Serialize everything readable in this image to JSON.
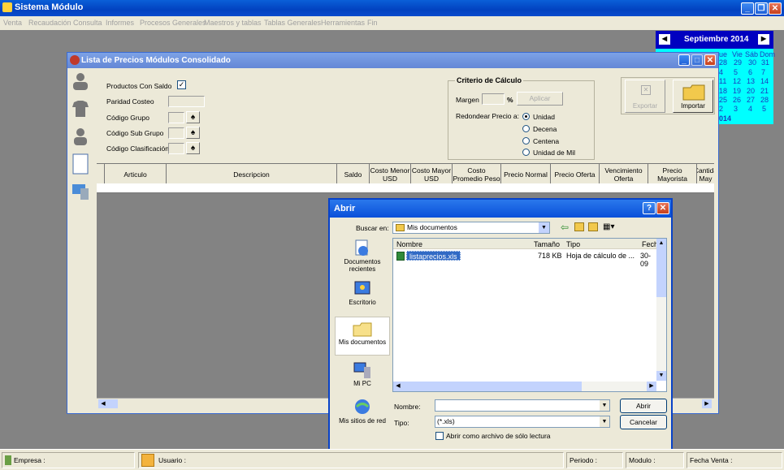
{
  "app": {
    "title": "Sistema Módulo"
  },
  "menu": [
    "Venta",
    "Recaudación",
    "Consulta",
    "Informes",
    "Procesos Generales",
    "Maestros y tablas",
    "Tablas Generales",
    "Herramientas",
    "Fin"
  ],
  "calendar": {
    "month_label": "Septiembre 2014",
    "day_headers": [
      "ue",
      "Vie",
      "Sáb",
      "Dom"
    ],
    "rows": [
      [
        "28",
        "29",
        "30",
        "31"
      ],
      [
        "4",
        "5",
        "6",
        "7"
      ],
      [
        "11",
        "12",
        "13",
        "14"
      ],
      [
        "18",
        "19",
        "20",
        "21"
      ],
      [
        "25",
        "26",
        "27",
        "28"
      ],
      [
        "2",
        "3",
        "4",
        "5"
      ]
    ],
    "footer": "014"
  },
  "window": {
    "title": "Lista de Precios Módulos Consolidado",
    "filters": {
      "productos_con_saldo": "Productos Con Saldo",
      "paridad_costeo": "Paridad Costeo",
      "codigo_grupo": "Código Grupo",
      "codigo_sub_grupo": "Código Sub Grupo",
      "codigo_clasificacion": "Código Clasificación"
    },
    "criterio": {
      "title": "Criterio de Cálculo",
      "margen_label": "Margen",
      "percent": "%",
      "aplicar": "Aplicar",
      "redondear_label": "Redondear Precio a:",
      "options": [
        "Unidad",
        "Decena",
        "Centena",
        "Unidad de Mil"
      ],
      "selected": "Unidad"
    },
    "buttons": {
      "exportar": "Exportar",
      "importar": "Importar"
    },
    "grid_headers": [
      "Articulo",
      "Descripcion",
      "Saldo",
      "Costo Menor USD",
      "Costo Mayor USD",
      "Costo Promedio Peso",
      "Precio Normal",
      "Precio Oferta",
      "Vencimiento Oferta",
      "Precio Mayorista",
      "Cantida May"
    ]
  },
  "dialog": {
    "title": "Abrir",
    "look_in_label": "Buscar en:",
    "look_in_value": "Mis documentos",
    "places": [
      "Documentos recientes",
      "Escritorio",
      "Mis documentos",
      "Mi PC",
      "Mis sitios de red"
    ],
    "columns": [
      "Nombre",
      "Tamaño",
      "Tipo",
      "Fech"
    ],
    "files": [
      {
        "name": "listaprecios.xls",
        "size": "718 KB",
        "type": "Hoja de cálculo de ...",
        "date": "30-09"
      }
    ],
    "filename_label": "Nombre:",
    "filename_value": "",
    "filetype_label": "Tipo:",
    "filetype_value": "(*.xls)",
    "readonly_label": "Abrir como archivo de sólo lectura",
    "open_button": "Abrir",
    "cancel_button": "Cancelar"
  },
  "statusbar": {
    "empresa": "Empresa :",
    "usuario": "Usuario :",
    "periodo": "Periodo :",
    "modulo": "Modulo :",
    "fecha_venta": "Fecha Venta :"
  },
  "colors": {
    "title_blue": "#0242c0",
    "calendar_bg": "#00ffff",
    "calendar_head": "#0000c0",
    "desktop": "#838383"
  }
}
